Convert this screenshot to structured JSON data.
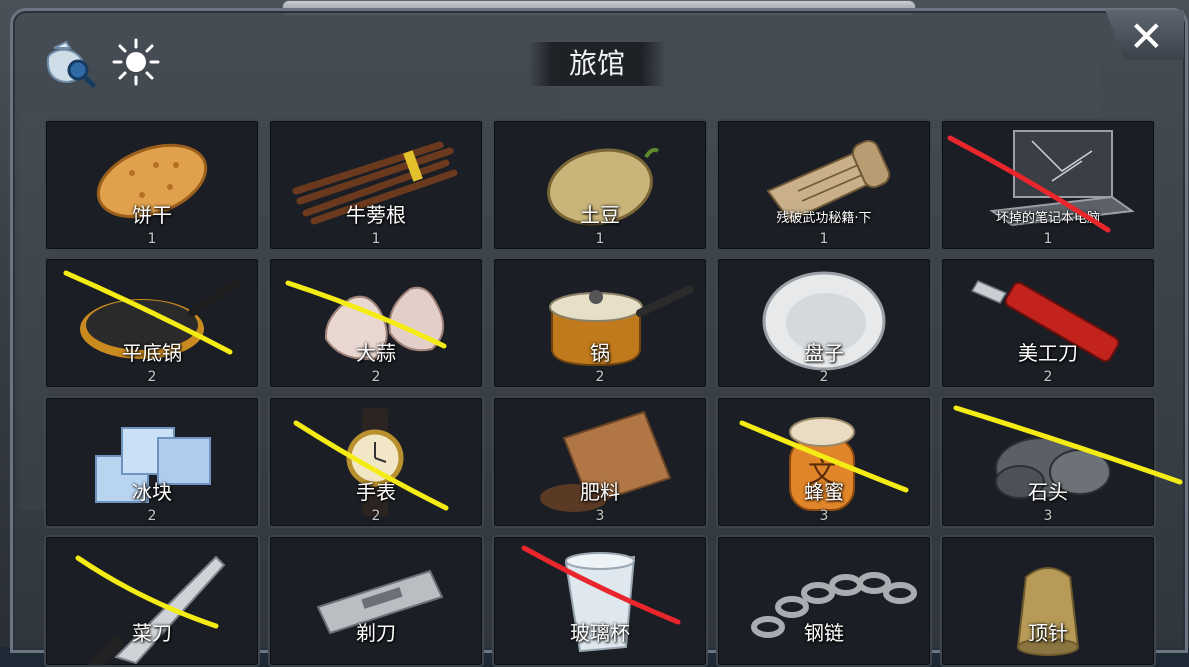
{
  "title": "旅馆",
  "close_label": "✕",
  "toolbar": {
    "search_icon": "bag-magnifier-icon",
    "sun_icon": "sun-icon"
  },
  "items": [
    {
      "name": "饼干",
      "qty": "1",
      "icon": "biscuit-icon"
    },
    {
      "name": "牛蒡根",
      "qty": "1",
      "icon": "burdock-root-icon"
    },
    {
      "name": "土豆",
      "qty": "1",
      "icon": "potato-icon"
    },
    {
      "name": "残破武功秘籍·下",
      "qty": "1",
      "icon": "scroll-icon"
    },
    {
      "name": "坏掉的笔记本电脑",
      "qty": "1",
      "icon": "broken-laptop-icon"
    },
    {
      "name": "平底锅",
      "qty": "2",
      "icon": "frying-pan-icon"
    },
    {
      "name": "大蒜",
      "qty": "2",
      "icon": "garlic-icon"
    },
    {
      "name": "锅",
      "qty": "2",
      "icon": "pot-icon"
    },
    {
      "name": "盘子",
      "qty": "2",
      "icon": "plate-icon"
    },
    {
      "name": "美工刀",
      "qty": "2",
      "icon": "utility-knife-icon"
    },
    {
      "name": "冰块",
      "qty": "2",
      "icon": "ice-cubes-icon"
    },
    {
      "name": "手表",
      "qty": "2",
      "icon": "watch-icon"
    },
    {
      "name": "肥料",
      "qty": "3",
      "icon": "fertilizer-bag-icon"
    },
    {
      "name": "蜂蜜",
      "qty": "3",
      "icon": "honey-jar-icon"
    },
    {
      "name": "石头",
      "qty": "3",
      "icon": "stones-icon"
    },
    {
      "name": "菜刀",
      "qty": "",
      "icon": "kitchen-knife-icon"
    },
    {
      "name": "剃刀",
      "qty": "",
      "icon": "razor-blade-icon"
    },
    {
      "name": "玻璃杯",
      "qty": "",
      "icon": "glass-cup-icon"
    },
    {
      "name": "钢链",
      "qty": "",
      "icon": "steel-chain-icon"
    },
    {
      "name": "顶针",
      "qty": "",
      "icon": "thimble-icon"
    }
  ],
  "annotations": {
    "red_strike_color": "#e8262c",
    "yellow_strike_color": "#f5ec15"
  }
}
